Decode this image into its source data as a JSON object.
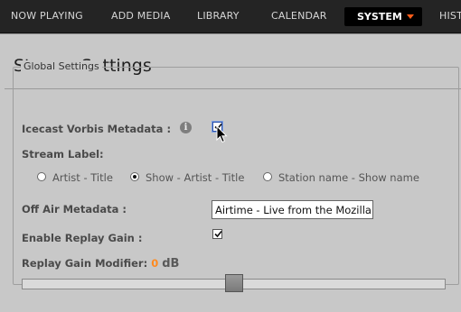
{
  "nav": {
    "items": [
      "NOW PLAYING",
      "ADD MEDIA",
      "LIBRARY",
      "CALENDAR"
    ],
    "active": "SYSTEM",
    "overflow": "HIST"
  },
  "page": {
    "title": "Stream Settings"
  },
  "global": {
    "legend": "Global Settings",
    "icecast_label": "Icecast Vorbis Metadata :",
    "icecast_checked": true,
    "info_icon": "i",
    "stream_label": "Stream Label:",
    "radio_options": [
      "Artist - Title",
      "Show - Artist - Title",
      "Station name - Show name"
    ],
    "radio_selected_index": 1,
    "off_air_label": "Off Air Metadata :",
    "off_air_value": "Airtime - Live from the Mozilla Firefox",
    "replay_gain_label": "Enable Replay Gain :",
    "replay_gain_checked": true,
    "modifier_label": "Replay Gain Modifier:",
    "modifier_value": "0",
    "modifier_unit": "dB",
    "slider_fraction": 0.5
  },
  "colors": {
    "accent": "#ff8a1f",
    "nav_bg": "#242424",
    "panel_bg": "#c8c8c8"
  }
}
